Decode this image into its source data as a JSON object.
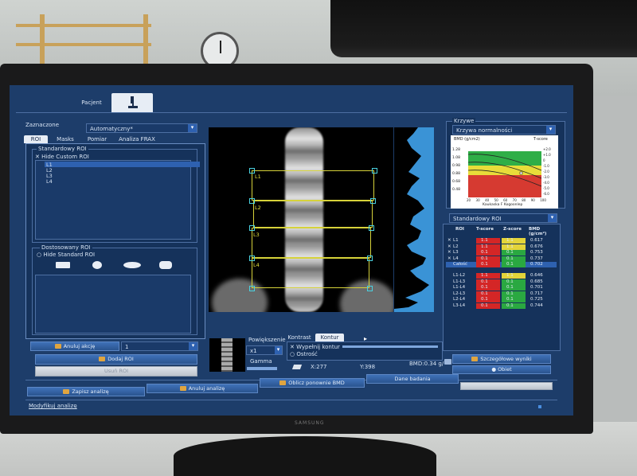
{
  "tabs": {
    "patient": "Pacjent"
  },
  "left": {
    "selected_label": "Zaznaczone",
    "selected_value": "Automatyczny*",
    "subtabs": [
      "ROI",
      "Masks",
      "Pomiar",
      "Analiza FRAX"
    ],
    "std_roi_title": "Standardowy ROI",
    "hide_custom": "Hide Custom ROI",
    "roi_items": [
      "L1",
      "L2",
      "L3",
      "L4"
    ],
    "custom_roi_title": "Dostosowany ROI",
    "hide_standard": "Hide Standard ROI",
    "undo_label": "Anuluj akcję",
    "undo_value": "1",
    "add_roi": "Dodaj ROI",
    "remove_roi": "Usuń ROI"
  },
  "scan": {
    "vertebra_labels": [
      "L1",
      "L2",
      "L3",
      "L4"
    ]
  },
  "controls": {
    "zoom_label": "Powiększenie",
    "zoom_value": "x1",
    "gamma_label": "Gamma",
    "contrast_tab": "Kontrast",
    "contour_tab": "Kontur",
    "fill_contour": "Wypełnij kontur",
    "clarity": "Ostrość",
    "x_readout": "X:277",
    "y_readout": "Y:398",
    "bmd_readout": "BMD:0.34 g/"
  },
  "right": {
    "curves_title": "Krzywe",
    "curve_select": "Krzywa normalności",
    "ylabel": "BMD (g/cm2)",
    "tscore_label": "T-score",
    "xlabel": "Kaukaska F Kogoonlep",
    "x_ticks": [
      "20",
      "30",
      "40",
      "50",
      "60",
      "70",
      "80",
      "90",
      "100"
    ],
    "y_ticks": [
      "1.28",
      "1.08",
      "0.98",
      "0.88",
      "0.68",
      "0.48"
    ],
    "t_ticks": [
      "+2.0",
      "+1.0",
      "0",
      "-1.0",
      "-2.0",
      "-3.0",
      "-4.0",
      "-5.0",
      "-6.0"
    ],
    "roi_select": "Standardowy ROI",
    "table_headers": [
      "ROI",
      "T-score",
      "Z-score",
      "BMD (g/cm²)"
    ],
    "rows": [
      {
        "roi": "L1",
        "t": "1.1",
        "z": "1.1",
        "bmd": "0.617",
        "tc": "#d42626",
        "zc": "#e3d43a",
        "sel": false,
        "chk": true
      },
      {
        "roi": "L2",
        "t": "1.1",
        "z": "1.1",
        "bmd": "0.676",
        "tc": "#d42626",
        "zc": "#e3d43a",
        "sel": false,
        "chk": true
      },
      {
        "roi": "L3",
        "t": "0.1",
        "z": "0.1",
        "bmd": "0.753",
        "tc": "#d42626",
        "zc": "#2aa841",
        "sel": false,
        "chk": true
      },
      {
        "roi": "L4",
        "t": "0.1",
        "z": "0.1",
        "bmd": "0.737",
        "tc": "#d42626",
        "zc": "#2aa841",
        "sel": false,
        "chk": true
      },
      {
        "roi": "Całość",
        "t": "0.1",
        "z": "0.1",
        "bmd": "0.702",
        "tc": "#d42626",
        "zc": "#2aa841",
        "sel": true,
        "chk": false
      },
      {
        "roi": "L1-L2",
        "t": "1.1",
        "z": "1.1",
        "bmd": "0.646",
        "tc": "#d42626",
        "zc": "#e3d43a",
        "sel": false,
        "chk": false
      },
      {
        "roi": "L1-L3",
        "t": "0.1",
        "z": "0.1",
        "bmd": "0.685",
        "tc": "#d42626",
        "zc": "#2aa841",
        "sel": false,
        "chk": false
      },
      {
        "roi": "L1-L4",
        "t": "0.1",
        "z": "0.1",
        "bmd": "0.701",
        "tc": "#d42626",
        "zc": "#2aa841",
        "sel": false,
        "chk": false
      },
      {
        "roi": "L2-L3",
        "t": "0.1",
        "z": "0.1",
        "bmd": "0.717",
        "tc": "#d42626",
        "zc": "#2aa841",
        "sel": false,
        "chk": false
      },
      {
        "roi": "L2-L4",
        "t": "0.1",
        "z": "0.1",
        "bmd": "0.725",
        "tc": "#d42626",
        "zc": "#2aa841",
        "sel": false,
        "chk": false
      },
      {
        "roi": "L3-L4",
        "t": "0.1",
        "z": "0.1",
        "bmd": "0.744",
        "tc": "#d42626",
        "zc": "#2aa841",
        "sel": false,
        "chk": false
      }
    ],
    "results_btn": "Szczegółowe wyniki",
    "close_btn": "Obiet"
  },
  "bottom": {
    "save": "Zapisz analizę",
    "cancel": "Anuluj analizę",
    "compute": "Oblicz ponownie BMD",
    "patient_data": "Dane badania",
    "status": "Modyfikuj analizę"
  },
  "colors": {
    "screen_bg": "#1d3d6a",
    "accent": "#2e61b0",
    "roi_box": "#d6d23a",
    "handle": "#4ad1e0"
  },
  "monitor_brand": "SAMSUNG"
}
